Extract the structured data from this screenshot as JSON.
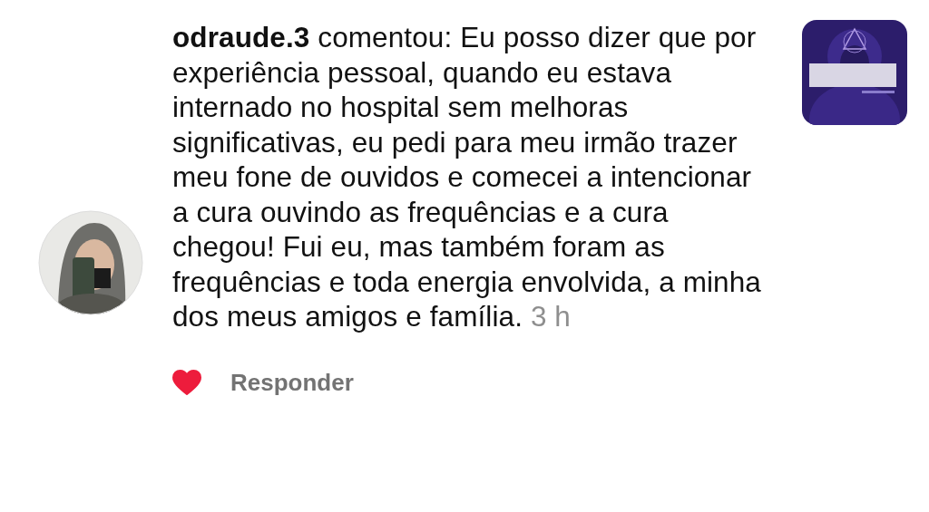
{
  "comment": {
    "username": "odraude.3",
    "text": "comentou: Eu posso dizer que por experiência pessoal, quando eu estava internado no hospital sem melhoras significativas, eu pedi para meu irmão trazer meu fone de ouvidos e comecei a intencionar a cura ouvindo as frequências e a cura chegou! Fui eu, mas também foram as frequências e toda energia envolvida, a minha dos meus amigos e família.",
    "time": "3 h",
    "liked": true,
    "reply_label": "Responder"
  }
}
